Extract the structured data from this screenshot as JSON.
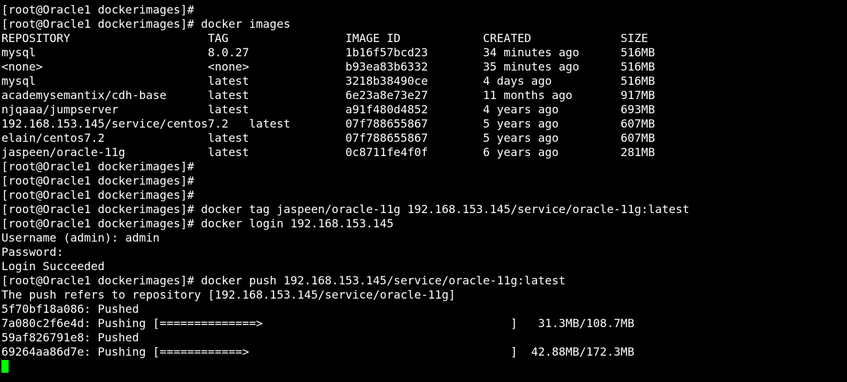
{
  "terminal": {
    "cursor_color": "#00ff00",
    "text_color": "#ffffff",
    "background_color": "#000000",
    "lines": [
      "[root@Oracle1 dockerimages]#",
      "[root@Oracle1 dockerimages]# docker images",
      "REPOSITORY                    TAG                 IMAGE ID            CREATED             SIZE",
      "mysql                         8.0.27              1b16f57bcd23        34 minutes ago      516MB",
      "<none>                        <none>              b93ea83b6332        35 minutes ago      516MB",
      "mysql                         latest              3218b38490ce        4 days ago          516MB",
      "academysemantix/cdh-base      latest              6e23a8e73e27        11 months ago       917MB",
      "njqaaa/jumpserver             latest              a91f480d4852        4 years ago         693MB",
      "192.168.153.145/service/centos7.2   latest        07f788655867        5 years ago         607MB",
      "elain/centos7.2               latest              07f788655867        5 years ago         607MB",
      "jaspeen/oracle-11g            latest              0c8711fe4f0f        6 years ago         281MB",
      "[root@Oracle1 dockerimages]#",
      "[root@Oracle1 dockerimages]#",
      "[root@Oracle1 dockerimages]#",
      "[root@Oracle1 dockerimages]# docker tag jaspeen/oracle-11g 192.168.153.145/service/oracle-11g:latest",
      "[root@Oracle1 dockerimages]# docker login 192.168.153.145",
      "Username (admin): admin",
      "Password:",
      "Login Succeeded",
      "[root@Oracle1 dockerimages]# docker push 192.168.153.145/service/oracle-11g:latest",
      "The push refers to repository [192.168.153.145/service/oracle-11g]",
      "5f70bf18a086: Pushed",
      "7a080c2f6e4d: Pushing [==============>                                    ]   31.3MB/108.7MB",
      "59af826791e8: Pushed",
      "69264aa86d7e: Pushing [============>                                      ]  42.88MB/172.3MB"
    ]
  }
}
